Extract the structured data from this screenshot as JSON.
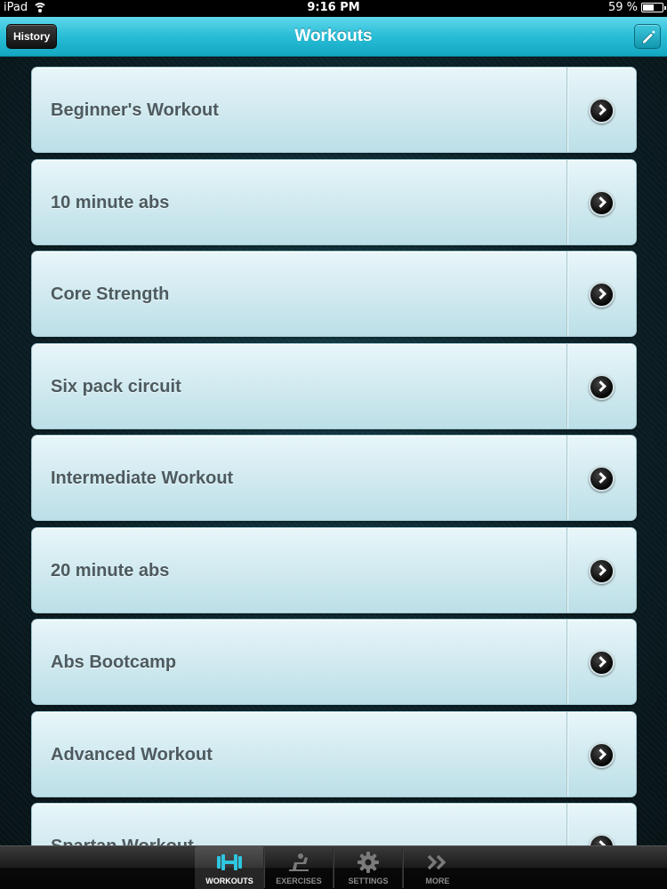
{
  "status_bar": {
    "device": "iPad",
    "time": "9:16 PM",
    "battery": "59 %",
    "battery_level": 0.59
  },
  "nav": {
    "title": "Workouts",
    "history_label": "History",
    "edit_icon": "pencil-icon"
  },
  "workouts": [
    {
      "label": "Beginner's Workout"
    },
    {
      "label": "10 minute abs"
    },
    {
      "label": "Core Strength"
    },
    {
      "label": "Six pack circuit"
    },
    {
      "label": "Intermediate Workout"
    },
    {
      "label": "20 minute abs"
    },
    {
      "label": "Abs Bootcamp"
    },
    {
      "label": "Advanced Workout"
    },
    {
      "label": "Spartan Workout"
    }
  ],
  "tabs": [
    {
      "label": "WORKOUTS",
      "icon": "dumbbell-icon",
      "active": true
    },
    {
      "label": "EXERCISES",
      "icon": "exercise-bench-icon",
      "active": false
    },
    {
      "label": "SETTINGS",
      "icon": "gear-icon",
      "active": false
    },
    {
      "label": "MORE",
      "icon": "double-chevron-icon",
      "active": false
    }
  ],
  "colors": {
    "accent": "#28bdd6",
    "row_text": "#4d5a5e",
    "active_tab_icon": "#2fc6e0"
  }
}
